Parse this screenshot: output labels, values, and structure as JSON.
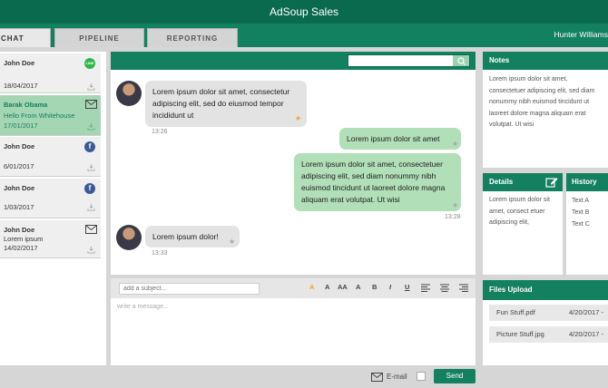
{
  "app": {
    "title": "AdSoup Sales",
    "user": "Hunter Williams"
  },
  "tabs": [
    {
      "label": "CHAT"
    },
    {
      "label": "PIPELINE"
    },
    {
      "label": "REPORTING"
    }
  ],
  "contacts": [
    {
      "name": "John Doe",
      "line2": "",
      "date": "18/04/2017",
      "channel": "line-icon",
      "channel_text": "LINE"
    },
    {
      "name": "Barak Obama",
      "line2": "Hello From Whitehouse",
      "date": "17/01/2017",
      "channel": "mail-icon"
    },
    {
      "name": "John Doe",
      "line2": "",
      "date": "6/01/2017",
      "channel": "facebook-icon",
      "channel_text": "f"
    },
    {
      "name": "John Doe",
      "line2": "",
      "date": "1/03/2017",
      "channel": "facebook-icon",
      "channel_text": "f"
    },
    {
      "name": "John Doe",
      "line2": "Lorem ipsum",
      "date": "14/02/2017",
      "channel": "mail-icon"
    }
  ],
  "chat": {
    "messages": [
      {
        "direction": "in",
        "text": "Lorem ipsum dolor sit amet, consectetur adipiscing elit, sed do eiusmod tempor incididunt ut",
        "time": "13:26",
        "starred": true
      },
      {
        "direction": "out",
        "text": "Lorem ipsum dolor sit amet",
        "time": "",
        "starred": false
      },
      {
        "direction": "out",
        "text": "Lorem ipsum dolor sit amet, consectetuer adipiscing elit, sed diam nonummy nibh euismod tincidunt ut laoreet dolore magna aliquam erat volutpat. Ut wisi",
        "time": "13:28",
        "starred": false
      },
      {
        "direction": "in",
        "text": "Lorem ipsum dolor!",
        "time": "13:33",
        "starred": false
      }
    ]
  },
  "composer": {
    "subject_placeholder": "add a subject...",
    "message_placeholder": "write a message...",
    "email_label": "E-mail",
    "send_label": "Send",
    "format_buttons": {
      "a_small": "A",
      "a_case": "A",
      "aa": "AA",
      "a_super": "A",
      "bold": "B",
      "italic": "I",
      "underline": "U"
    }
  },
  "notes": {
    "title": "Notes",
    "body": "Lorem ipsum dolor sit amet, consectetuer adipiscing elit, sed diam nonummy nibh euismod tincidunt ut laoreet dolore magna aliquam erat volutpat. Ut wisi"
  },
  "details": {
    "title": "Details",
    "body": "Lorem ipsum dolor sit amet, consect etuer adipiscing elit,"
  },
  "history": {
    "title": "History",
    "items": [
      "Text A",
      "Text B",
      "Text C"
    ]
  },
  "files": {
    "title": "Files Upload",
    "items": [
      {
        "name": "Fun Stuff.pdf",
        "date": "4/20/2017 -"
      },
      {
        "name": "Picture Stuff.jpg",
        "date": "4/20/2017 -"
      }
    ]
  },
  "colors": {
    "primary": "#13805f",
    "title_bar": "#0a6a4e",
    "bubble_out": "#b1dfb8",
    "bubble_in": "#e3e3e3",
    "star": "#f0a430",
    "contact_active": "#a5d6b4"
  }
}
